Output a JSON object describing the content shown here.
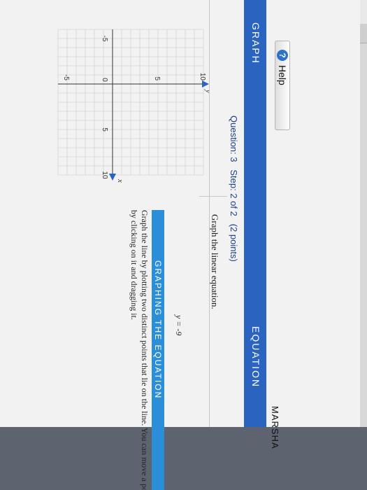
{
  "header": {
    "help_label": "Help",
    "user_name": "MARSHA",
    "graph_title": "GRAPH",
    "equation_title": "EQUATION",
    "question_label": "Question: 3",
    "step_label": "Step: 2 of 2",
    "points_label": "(2 points)"
  },
  "graph": {
    "x_axis_label": "x",
    "y_axis_label": "y",
    "x_ticks": [
      "-5",
      "0",
      "5",
      "10"
    ],
    "y_ticks": [
      "-5",
      "5",
      "10"
    ],
    "xlim": [
      -6,
      10
    ],
    "ylim": [
      -6,
      10
    ]
  },
  "main": {
    "instruction": "Graph the linear equation.",
    "equation": "y = -9",
    "section_title": "GRAPHING THE EQUATION",
    "section_text": "Graph the line by plotting two distinct points that lie on the line. You can move a point by clicking on it and dragging it."
  },
  "colors": {
    "header_blue": "#2a64c0",
    "section_blue": "#2a8ed8",
    "help_icon_blue": "#2d73c9"
  },
  "icons": {
    "help": "question-circle-icon",
    "axis_arrow": "arrow-icon"
  }
}
